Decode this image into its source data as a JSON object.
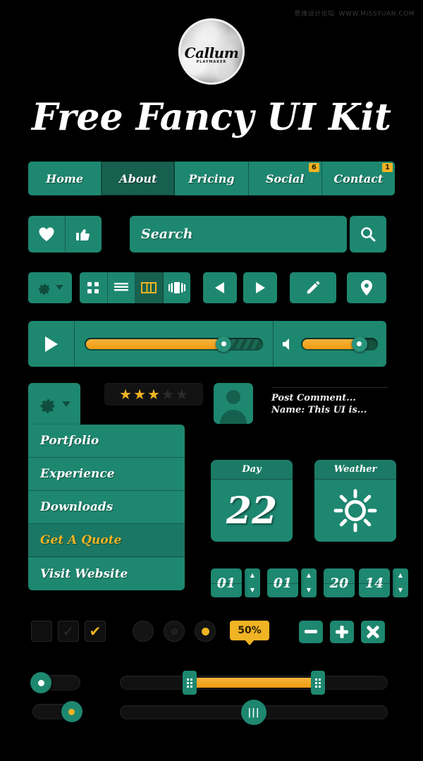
{
  "watermark": {
    "cn": "思缘设计论坛",
    "url": "WWW.MISSYUAN.COM"
  },
  "logo": {
    "name": "Callum",
    "subtitle": "PLAYMAKER"
  },
  "title": "Free Fancy UI Kit",
  "nav": {
    "items": [
      {
        "label": "Home",
        "active": false,
        "badge": ""
      },
      {
        "label": "About",
        "active": true,
        "badge": ""
      },
      {
        "label": "Pricing",
        "active": false,
        "badge": ""
      },
      {
        "label": "Social",
        "active": false,
        "badge": "6"
      },
      {
        "label": "Contact",
        "active": false,
        "badge": "1"
      }
    ]
  },
  "actions": {
    "heart": "♥",
    "thumb": "👍"
  },
  "search": {
    "placeholder": "Search"
  },
  "toolbar": {
    "gear_label": "settings",
    "views": [
      {
        "name": "grid",
        "active": false
      },
      {
        "name": "list",
        "active": false
      },
      {
        "name": "columns",
        "active": true
      },
      {
        "name": "coverflow",
        "active": false
      }
    ],
    "prev": "prev",
    "next": "next",
    "edit": "edit",
    "location": "location"
  },
  "player": {
    "play": "play",
    "progress_percent": 78,
    "buffer_percent": 12,
    "volume_label": "volume",
    "volume_percent": 76
  },
  "rating": {
    "value": 3,
    "max": 5
  },
  "comment": {
    "line1": "Post Comment...",
    "line2": "Name: This UI is..."
  },
  "menu": {
    "items": [
      {
        "label": "Portfolio",
        "highlight": false
      },
      {
        "label": "Experience",
        "highlight": false
      },
      {
        "label": "Downloads",
        "highlight": false
      },
      {
        "label": "Get A Quote",
        "highlight": true
      },
      {
        "label": "Visit Website",
        "highlight": false
      }
    ]
  },
  "widgets": {
    "day": {
      "caption": "Day",
      "value": "22"
    },
    "weather": {
      "caption": "Weather",
      "icon": "sun-icon"
    }
  },
  "steppers": [
    {
      "value": "01"
    },
    {
      "value": "01"
    },
    {
      "value": "20"
    },
    {
      "value": "14"
    }
  ],
  "checkboxes": [
    {
      "state": "empty",
      "mark": ""
    },
    {
      "state": "dim",
      "mark": "✓"
    },
    {
      "state": "checked",
      "mark": "✔"
    }
  ],
  "radios": [
    {
      "state": "empty"
    },
    {
      "state": "hover"
    },
    {
      "state": "selected"
    }
  ],
  "tooltip": {
    "value": "50%"
  },
  "pmx": [
    {
      "name": "minus",
      "glyph": "—"
    },
    {
      "name": "plus",
      "glyph": "+"
    },
    {
      "name": "close",
      "glyph": "✕"
    }
  ],
  "toggles": [
    {
      "state": "off",
      "position_percent": 0
    },
    {
      "state": "on",
      "position_percent": 100
    }
  ],
  "range_slider": {
    "low_percent": 26,
    "high_percent": 74
  },
  "single_slider": {
    "value_percent": 50,
    "grip": "|||"
  },
  "colors": {
    "background": "#000000",
    "green": "#1e8770",
    "green_dark": "#17604f",
    "amber": "#f0b323",
    "orange": "#ef9c12",
    "white": "#ffffff"
  }
}
